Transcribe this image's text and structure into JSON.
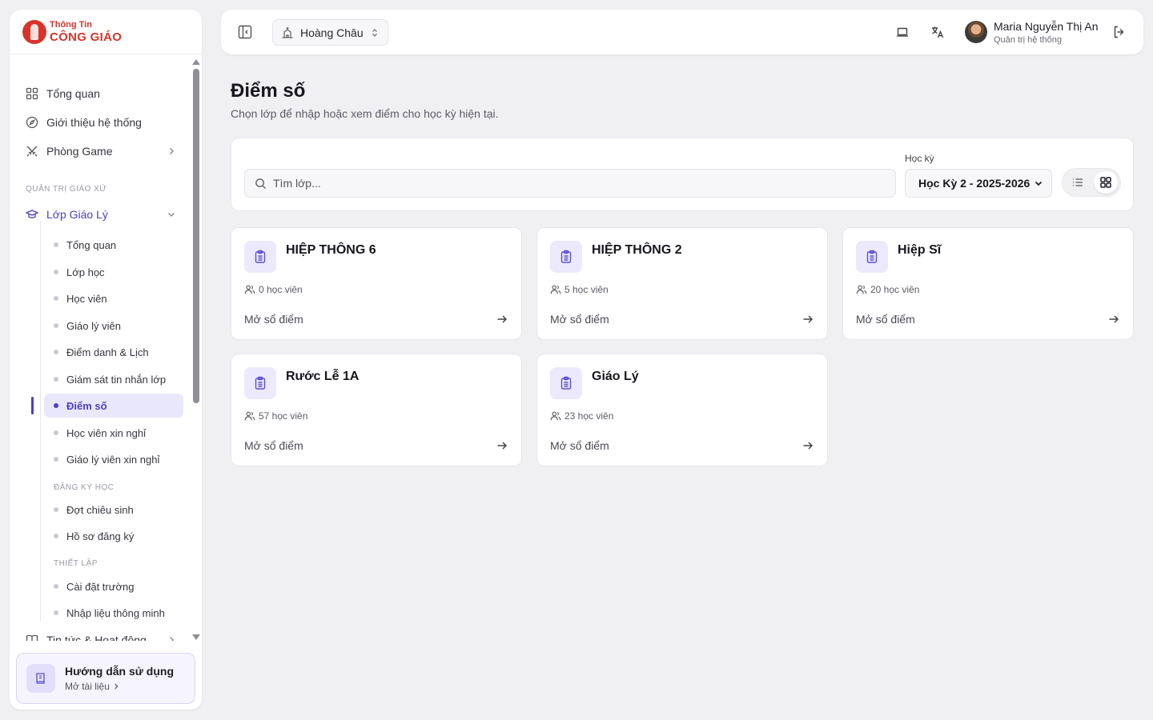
{
  "brand": {
    "line1": "Thông Tin",
    "line2": "CÔNG GIÁO"
  },
  "sidebar": {
    "top_items": [
      {
        "label": "Tổng quan",
        "icon": "grid-icon"
      },
      {
        "label": "Giới thiệu hệ thống",
        "icon": "compass-icon"
      },
      {
        "label": "Phòng Game",
        "icon": "swords-icon"
      }
    ],
    "section_admin": "QUẢN TRỊ GIÁO XỨ",
    "group": {
      "label": "Lớp Giáo Lý",
      "icon": "graduation-cap-icon",
      "expanded": true
    },
    "sub_items": [
      "Tổng quan",
      "Lớp học",
      "Học viên",
      "Giáo lý viên",
      "Điểm danh & Lịch",
      "Giám sát tin nhắn lớp",
      "Điểm số",
      "Học viên xin nghỉ",
      "Giáo lý viên xin nghỉ"
    ],
    "active_sub": "Điểm số",
    "section_registration": "ĐĂNG KÝ HỌC",
    "registration_items": [
      "Đợt chiêu sinh",
      "Hồ sơ đăng ký"
    ],
    "section_setup": "THIẾT LẬP",
    "setup_items": [
      "Cài đặt trường",
      "Nhập liệu thông minh"
    ],
    "news_item": {
      "label": "Tin tức & Hoạt động",
      "icon": "book-open-icon"
    },
    "guide": {
      "title": "Hướng dẫn sử dụng",
      "link": "Mở tài liệu",
      "icon": "book-icon"
    }
  },
  "header": {
    "parish": "Hoàng Châu",
    "user": {
      "name": "Maria Nguyễn Thị An",
      "role": "Quản trị hệ thống"
    }
  },
  "main": {
    "title": "Điểm số",
    "subtitle": "Chọn lớp để nhập hoặc xem điểm cho học kỳ hiện tại.",
    "search_placeholder": "Tìm lớp...",
    "term_label": "Học kỳ",
    "term_value": "Học Kỳ 2 - 2025-2026",
    "view_mode": "grid",
    "classes": [
      {
        "name": "HIỆP THÔNG 6",
        "count": "0 học viên",
        "link": "Mở sổ điểm"
      },
      {
        "name": "HIỆP THÔNG 2",
        "count": "5 học viên",
        "link": "Mở sổ điểm"
      },
      {
        "name": "Hiệp Sĩ",
        "count": "20 học viên",
        "link": "Mở sổ điểm"
      },
      {
        "name": "Rước Lễ 1A",
        "count": "57 học viên",
        "link": "Mở sổ điểm"
      },
      {
        "name": "Giáo Lý",
        "count": "23 học viên",
        "link": "Mở sổ điểm"
      }
    ]
  },
  "colors": {
    "accent": "#4b3fc4",
    "brand_red": "#d8342a",
    "background": "#f0f0f3"
  }
}
